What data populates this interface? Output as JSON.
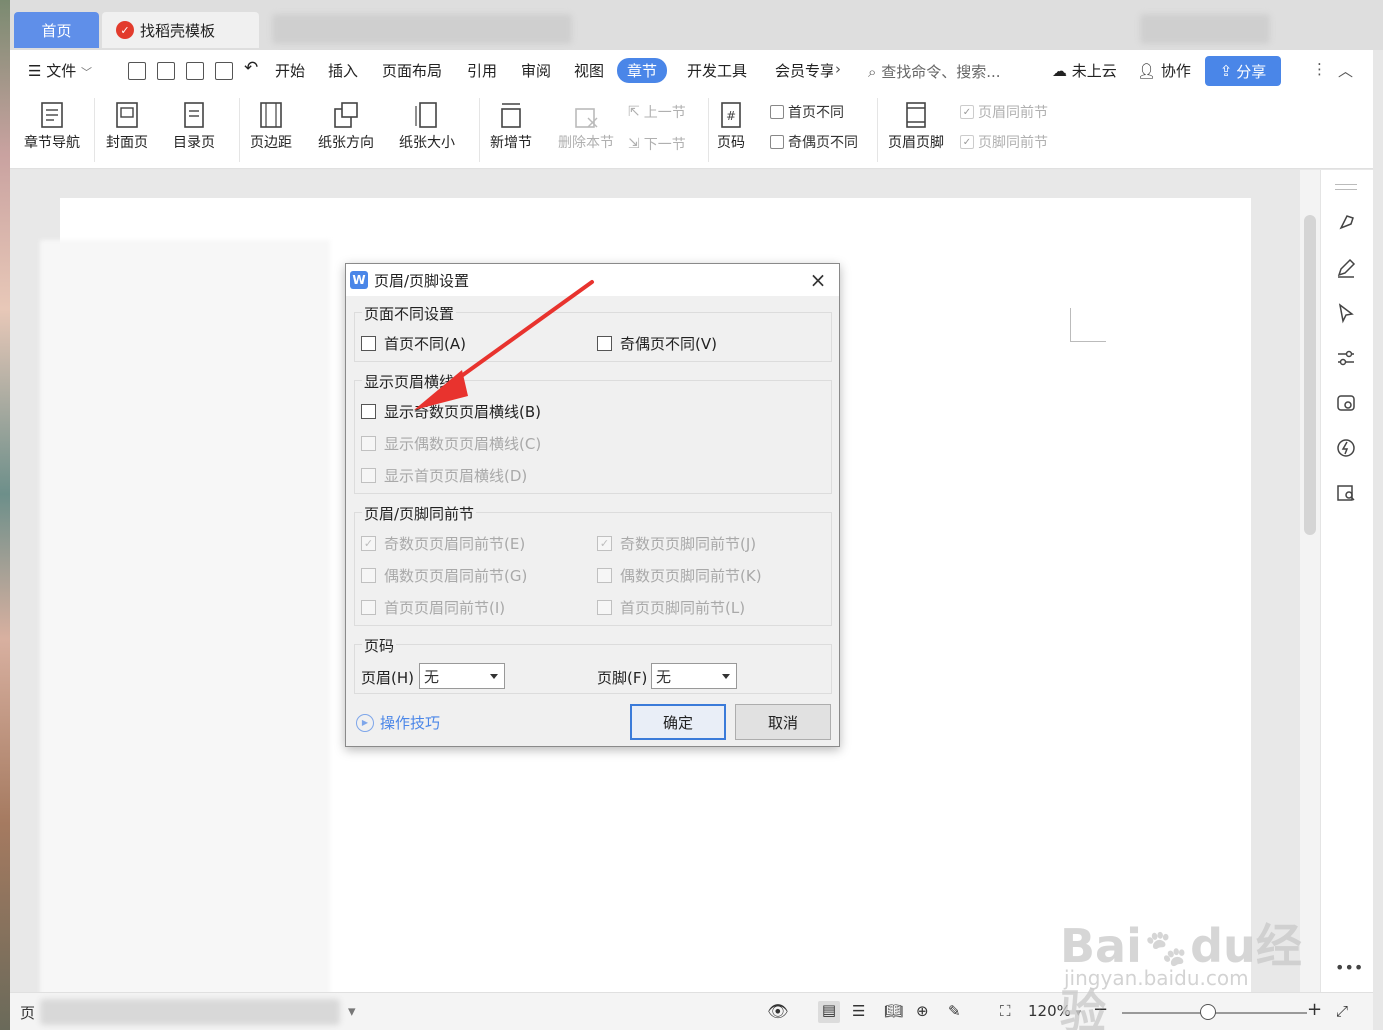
{
  "tabs": {
    "home": "首页",
    "template": "找稻壳模板"
  },
  "menu": {
    "file": "文件",
    "items": [
      "开始",
      "插入",
      "页面布局",
      "引用",
      "审阅",
      "视图",
      "章节",
      "开发工具",
      "会员专享"
    ],
    "search_placeholder": "查找命令、搜索...",
    "cloud": "未上云",
    "collab": "协作",
    "share": "分享"
  },
  "ribbon": {
    "chapter_nav": "章节导航",
    "cover": "封面页",
    "toc": "目录页",
    "margin": "页边距",
    "orientation": "纸张方向",
    "size": "纸张大小",
    "new_section": "新增节",
    "delete_section": "删除本节",
    "prev_section": "上一节",
    "next_section": "下一节",
    "page_number": "页码",
    "first_page_diff": "首页不同",
    "odd_even_diff": "奇偶页不同",
    "header_footer": "页眉页脚",
    "header_same_prev": "页眉同前节",
    "footer_same_prev": "页脚同前节"
  },
  "dialog": {
    "title": "页眉/页脚设置",
    "group_page_diff": {
      "title": "页面不同设置",
      "first_page": "首页不同(A)",
      "odd_even": "奇偶页不同(V)"
    },
    "group_header_line": {
      "title": "显示页眉横线",
      "odd": "显示奇数页页眉横线(B)",
      "even": "显示偶数页页眉横线(C)",
      "first": "显示首页页眉横线(D)"
    },
    "group_same_prev": {
      "title": "页眉/页脚同前节",
      "odd_header": "奇数页页眉同前节(E)",
      "odd_footer": "奇数页页脚同前节(J)",
      "even_header": "偶数页页眉同前节(G)",
      "even_footer": "偶数页页脚同前节(K)",
      "first_header": "首页页眉同前节(I)",
      "first_footer": "首页页脚同前节(L)"
    },
    "group_page_number": {
      "title": "页码",
      "header_label": "页眉(H)",
      "header_value": "无",
      "footer_label": "页脚(F)",
      "footer_value": "无"
    },
    "tips": "操作技巧",
    "ok": "确定",
    "cancel": "取消"
  },
  "statusbar": {
    "page": "页",
    "zoom": "120%"
  },
  "watermark": {
    "brand": "Bai",
    "brand2": "du",
    "brand3": "经验",
    "url": "jingyan.baidu.com"
  },
  "colors": {
    "accent": "#4a86e8",
    "annotation": "#e8332e"
  }
}
